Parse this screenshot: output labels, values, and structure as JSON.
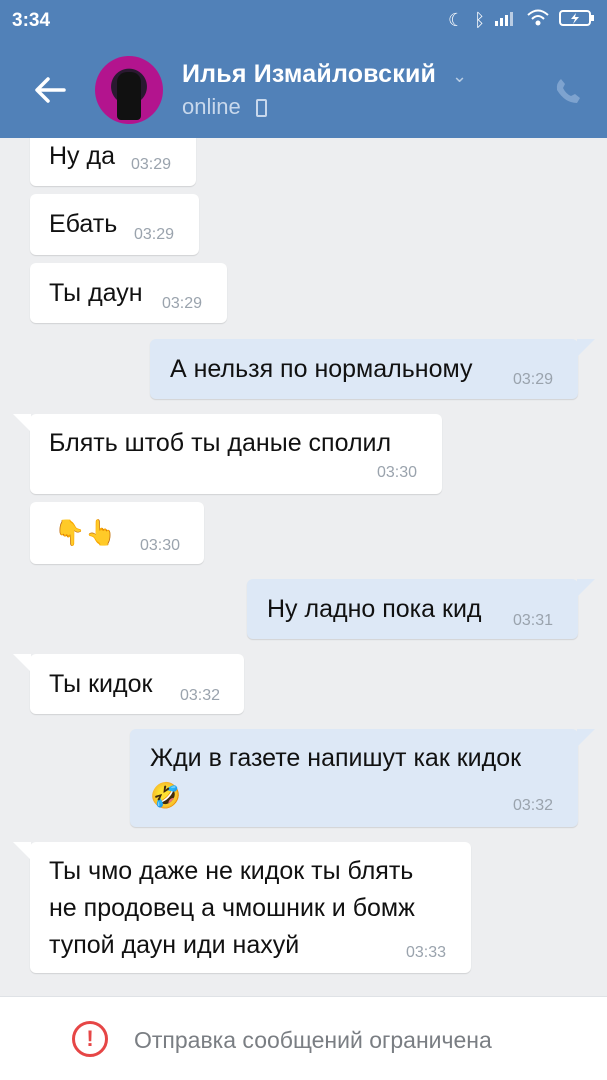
{
  "statusbar": {
    "time": "3:34",
    "icons": [
      "moon-icon",
      "bluetooth-icon",
      "signal-icon",
      "wifi-icon",
      "battery-charging-icon"
    ]
  },
  "header": {
    "name": "Илья Измайловский",
    "status": "online"
  },
  "messages": [
    {
      "text": "Ну да",
      "time": "03:29",
      "dir": "in"
    },
    {
      "text": "Ебать",
      "time": "03:29",
      "dir": "in"
    },
    {
      "text": "Ты даун",
      "time": "03:29",
      "dir": "in"
    },
    {
      "text": "А нельзя по нормальному",
      "time": "03:29",
      "dir": "out"
    },
    {
      "text": "Блять штоб ты даные сполил",
      "time": "03:30",
      "dir": "in"
    },
    {
      "text": "👇👆",
      "time": "03:30",
      "dir": "in"
    },
    {
      "text": "Ну ладно пока кид",
      "time": "03:31",
      "dir": "out"
    },
    {
      "text": "Ты кидок",
      "time": "03:32",
      "dir": "in"
    },
    {
      "text": "Жди в газете напишут как кидок",
      "emoji": "🤣",
      "time": "03:32",
      "dir": "out"
    },
    {
      "text_lines": [
        "Ты чмо даже не кидок ты блять",
        "не продовец а чмошник и бомж",
        "тупой даун иди нахуй"
      ],
      "time": "03:33",
      "dir": "in"
    }
  ],
  "footer": {
    "notice": "Отправка сообщений ограничена"
  },
  "colors": {
    "header": "#5181b8",
    "incoming": "#ffffff",
    "outgoing": "#dde8f6",
    "warning": "#e64646"
  }
}
